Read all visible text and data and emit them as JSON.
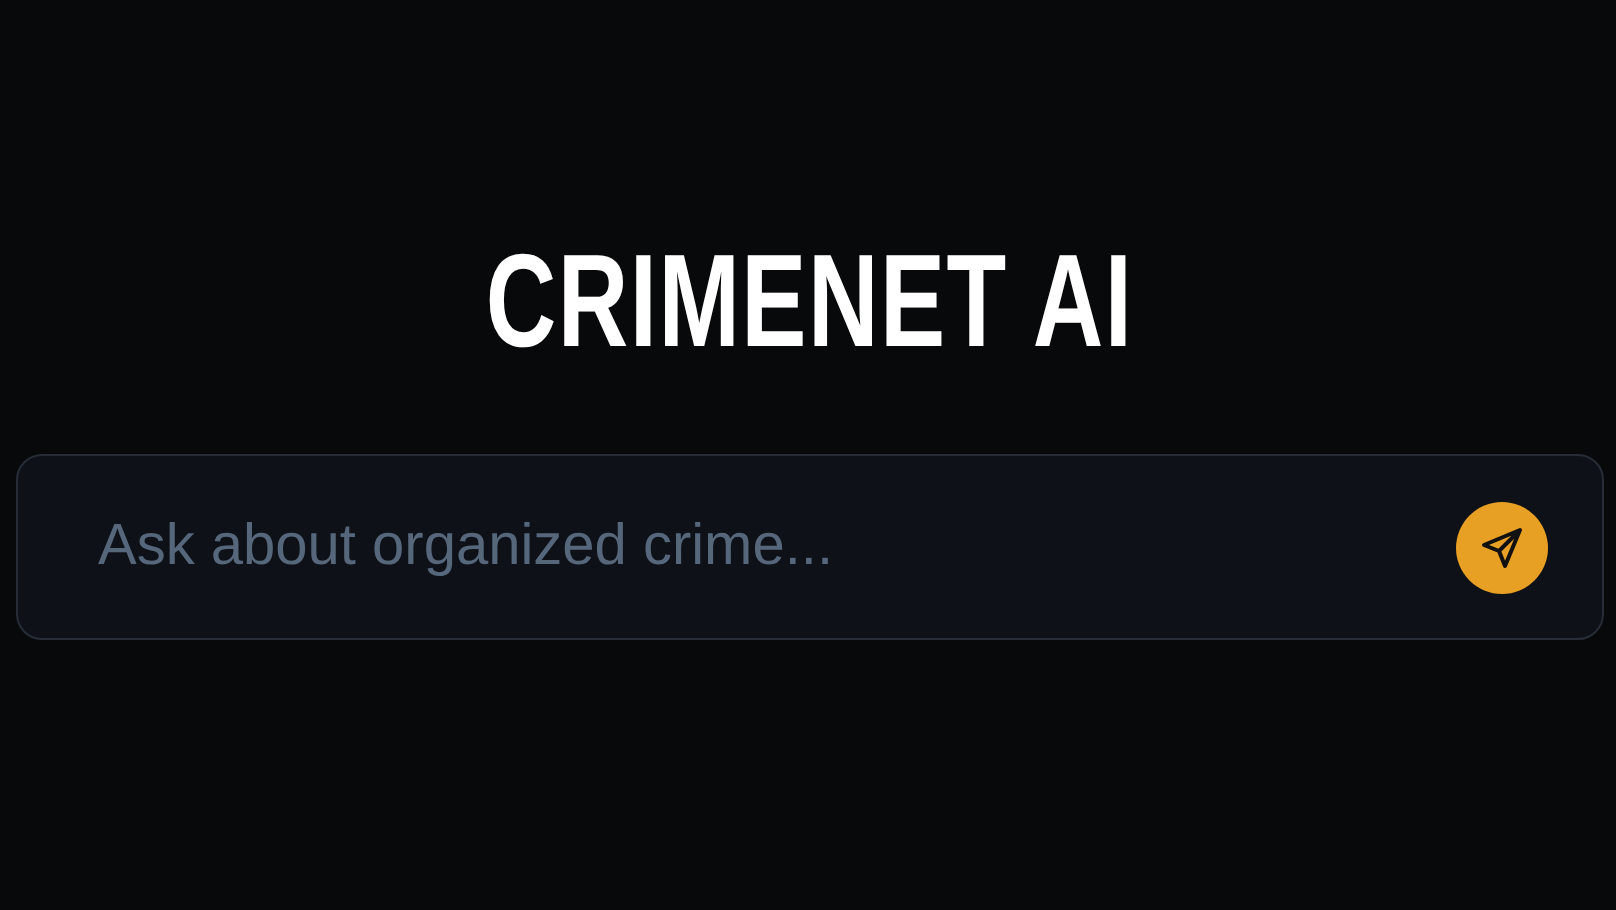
{
  "title": "CRIMENET AI",
  "search": {
    "placeholder": "Ask about organized crime..."
  }
}
